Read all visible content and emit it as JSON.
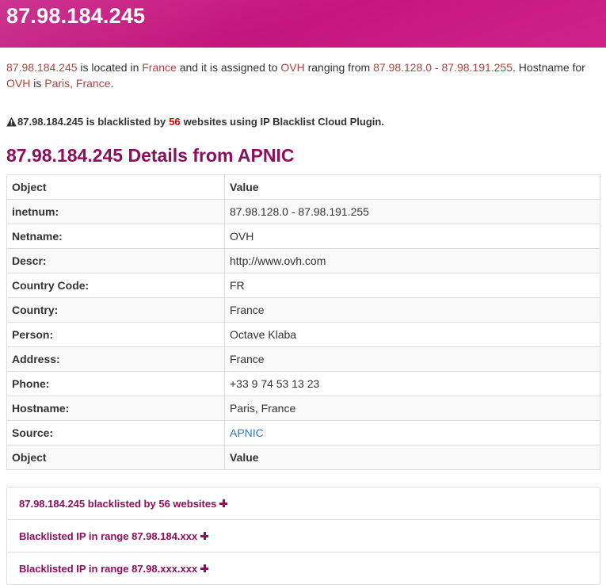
{
  "header": {
    "title": "87.98.184.245"
  },
  "intro": {
    "ip": "87.98.184.245",
    "t1": " is located in ",
    "country": "France",
    "t2": " and it is assigned to ",
    "org": "OVH",
    "t3": " ranging from ",
    "range": "87.98.128.0 - 87.98.191.255",
    "t4": ". Hostname for ",
    "org2": "OVH",
    "t5": " is ",
    "hostname": "Paris, France",
    "t6": "."
  },
  "warning": {
    "prefix": "87.98.184.245 is blacklisted by ",
    "count": "56",
    "suffix": " websites using IP Blacklist Cloud Plugin."
  },
  "details": {
    "title": "87.98.184.245 Details from APNIC",
    "header": {
      "col1": "Object",
      "col2": "Value"
    },
    "rows": [
      {
        "key": "inetnum:",
        "value": "87.98.128.0 - 87.98.191.255"
      },
      {
        "key": "Netname:",
        "value": "OVH"
      },
      {
        "key": "Descr:",
        "value": "http://www.ovh.com"
      },
      {
        "key": "Country Code:",
        "value": "FR"
      },
      {
        "key": "Country:",
        "value": "France"
      },
      {
        "key": "Person:",
        "value": "Octave Klaba"
      },
      {
        "key": "Address:",
        "value": "France"
      },
      {
        "key": "Phone:",
        "value": "+33 9 74 53 13 23"
      },
      {
        "key": "Hostname:",
        "value": "Paris, France"
      },
      {
        "key": "Source:",
        "value": "APNIC"
      }
    ],
    "footer": {
      "col1": "Object",
      "col2": "Value"
    }
  },
  "panels": [
    {
      "label": "87.98.184.245 blacklisted by 56 websites"
    },
    {
      "label": "Blacklisted IP in range 87.98.184.xxx"
    },
    {
      "label": "Blacklisted IP in range 87.98.xxx.xxx"
    }
  ],
  "colors": {
    "header_bg": "#cc1a86",
    "accent": "#8b0f5c",
    "highlight_text": "#a94442",
    "warning_number": "#e00000",
    "link": "#337ab7"
  }
}
